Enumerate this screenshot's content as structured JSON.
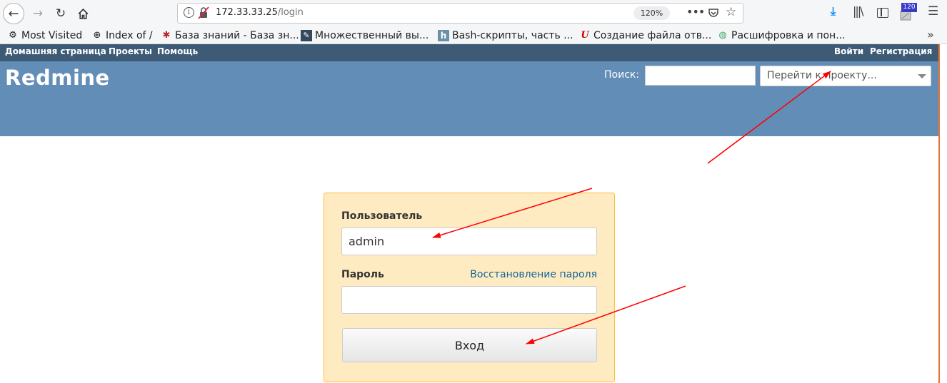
{
  "browser": {
    "url_host": "172.33.33.25",
    "url_path": "/login",
    "zoom": "120%",
    "extension_badge": "120",
    "icons": [
      "back-icon",
      "forward-icon",
      "reload-icon",
      "home-icon",
      "info-icon",
      "insecure-lock-icon",
      "page-actions-icon",
      "pocket-icon",
      "bookmark-star-icon",
      "download-icon",
      "library-icon",
      "sidebar-icon",
      "extension-icon",
      "menu-icon"
    ]
  },
  "bookmarks": [
    {
      "label": "Most Visited",
      "icon": "gear-icon"
    },
    {
      "label": "Index of /",
      "icon": "globe-icon"
    },
    {
      "label": "База знаний - База зн...",
      "icon": "bug-icon"
    },
    {
      "label": "Множественный вы...",
      "icon": "pen-icon"
    },
    {
      "label": "Bash-скрипты, часть ...",
      "icon": "h-icon"
    },
    {
      "label": "Создание файла отв...",
      "icon": "u-icon"
    },
    {
      "label": "Расшифровка и пон...",
      "icon": "globe-color-icon"
    }
  ],
  "top_menu": {
    "home": "Домашняя страница",
    "projects": "Проекты",
    "help": "Помощь",
    "login": "Войти",
    "register": "Регистрация"
  },
  "header": {
    "title": "Redmine",
    "search_label": "Поиск:",
    "project_select": "Перейти к проекту..."
  },
  "login_form": {
    "username_label": "Пользователь",
    "username_value": "admin",
    "password_label": "Пароль",
    "lost_password": "Восстановление пароля",
    "submit": "Вход"
  },
  "colors": {
    "top_menu_bg": "#3e5b76",
    "header_bg": "#628db6",
    "login_bg": "#ffebc1",
    "login_border": "#fdbf3b",
    "link": "#169",
    "annotation_arrow": "#ff0000"
  }
}
